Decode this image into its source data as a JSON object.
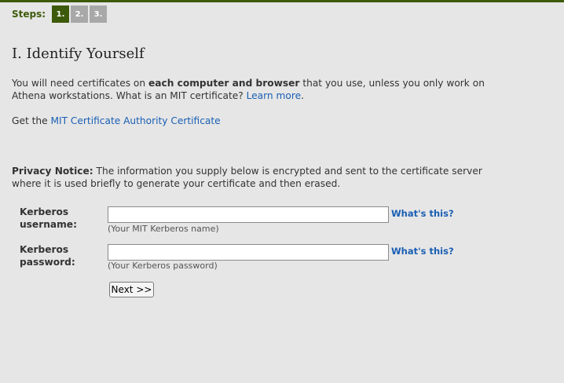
{
  "steps": {
    "label": "Steps:",
    "items": [
      "1.",
      "2.",
      "3."
    ],
    "active_index": 0,
    "accent_color": "#3d5a0a"
  },
  "title": "I. Identify Yourself",
  "intro": {
    "text_before": "You will need certificates on ",
    "bold": "each computer and browser",
    "text_after": " that you use, unless you only work on Athena workstations. What is an MIT certificate? ",
    "link": "Learn more",
    "end": "."
  },
  "ca": {
    "text": "Get the ",
    "link": "MIT Certificate Authority Certificate"
  },
  "privacy": {
    "label": "Privacy Notice:",
    "text": " The information you supply below is encrypted and sent to the certificate server where it is used briefly to generate your certificate and then erased."
  },
  "form": {
    "username": {
      "label_line1": "Kerberos",
      "label_line2": "username:",
      "value": "",
      "help_link": "What's this?",
      "hint": "(Your MIT Kerberos name)"
    },
    "password": {
      "label_line1": "Kerberos",
      "label_line2": "password:",
      "value": "",
      "help_link": "What's this?",
      "hint": "(Your Kerberos password)"
    },
    "next_label": "Next >>"
  }
}
